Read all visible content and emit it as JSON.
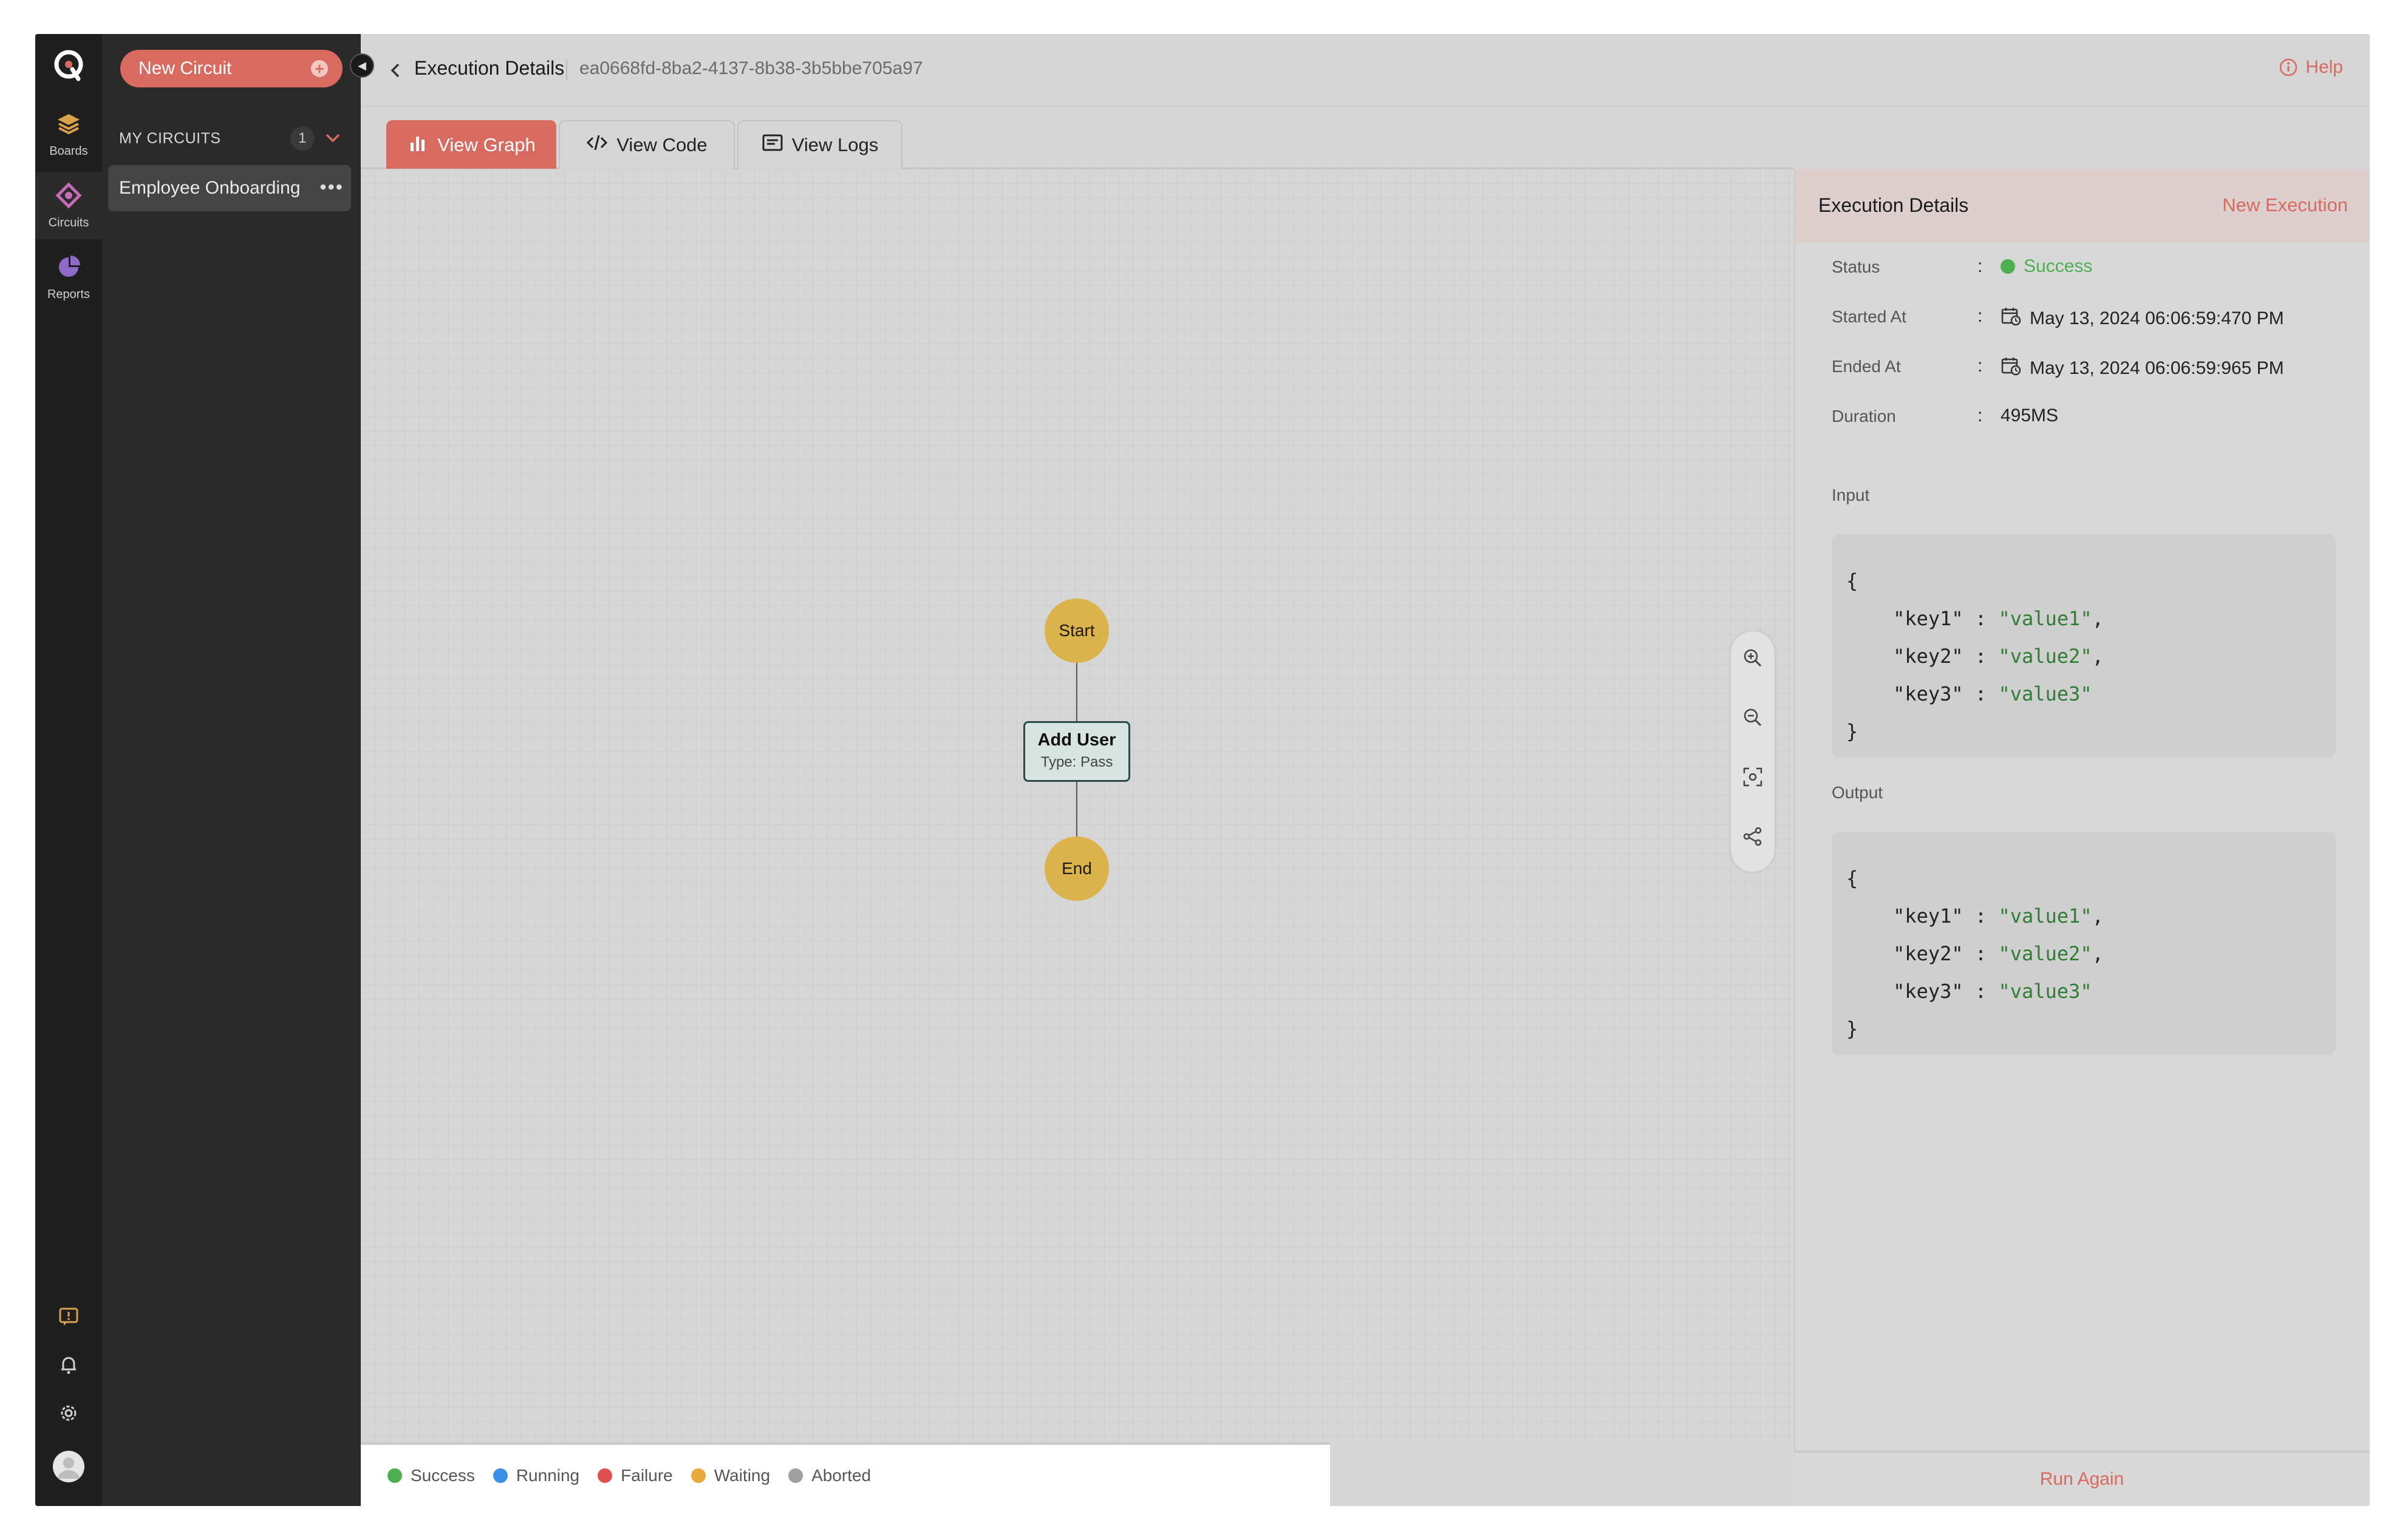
{
  "rail": {
    "items": [
      {
        "label": "Boards",
        "icon": "layers-icon"
      },
      {
        "label": "Circuits",
        "icon": "circuit-icon"
      },
      {
        "label": "Reports",
        "icon": "pie-chart-icon"
      }
    ]
  },
  "panel": {
    "new_circuit_label": "New Circuit",
    "section_title": "MY CIRCUITS",
    "count": "1",
    "circuits": [
      "Employee Onboarding"
    ]
  },
  "header": {
    "title": "Execution Details",
    "execution_id": "ea0668fd-8ba2-4137-8b38-3b5bbe705a97",
    "help_label": "Help"
  },
  "tabs": [
    "View Graph",
    "View Code",
    "View Logs"
  ],
  "graph": {
    "start_label": "Start",
    "node_title": "Add User",
    "node_type": "Type: Pass",
    "end_label": "End"
  },
  "legend": [
    {
      "label": "Success",
      "color": "#4caf50"
    },
    {
      "label": "Running",
      "color": "#3d8ee8"
    },
    {
      "label": "Failure",
      "color": "#e05050"
    },
    {
      "label": "Waiting",
      "color": "#e8a93c"
    },
    {
      "label": "Aborted",
      "color": "#a0a0a0"
    }
  ],
  "details": {
    "title": "Execution Details",
    "new_execution_label": "New Execution",
    "status_label": "Status",
    "status_value": "Success",
    "started_label": "Started At",
    "started_value": "May 13, 2024 06:06:59:470 PM",
    "ended_label": "Ended At",
    "ended_value": "May 13, 2024 06:06:59:965 PM",
    "duration_label": "Duration",
    "duration_value": "495MS",
    "input_label": "Input",
    "output_label": "Output",
    "json_pairs": [
      {
        "key": "\"key1\"",
        "value": "\"value1\"",
        "sep": ","
      },
      {
        "key": "\"key2\"",
        "value": "\"value2\"",
        "sep": ","
      },
      {
        "key": "\"key3\"",
        "value": "\"value3\"",
        "sep": ""
      }
    ],
    "run_again_label": "Run Again"
  },
  "colors": {
    "accent": "#d86a60",
    "success": "#4caf50",
    "node_yellow": "#dbb34a"
  }
}
